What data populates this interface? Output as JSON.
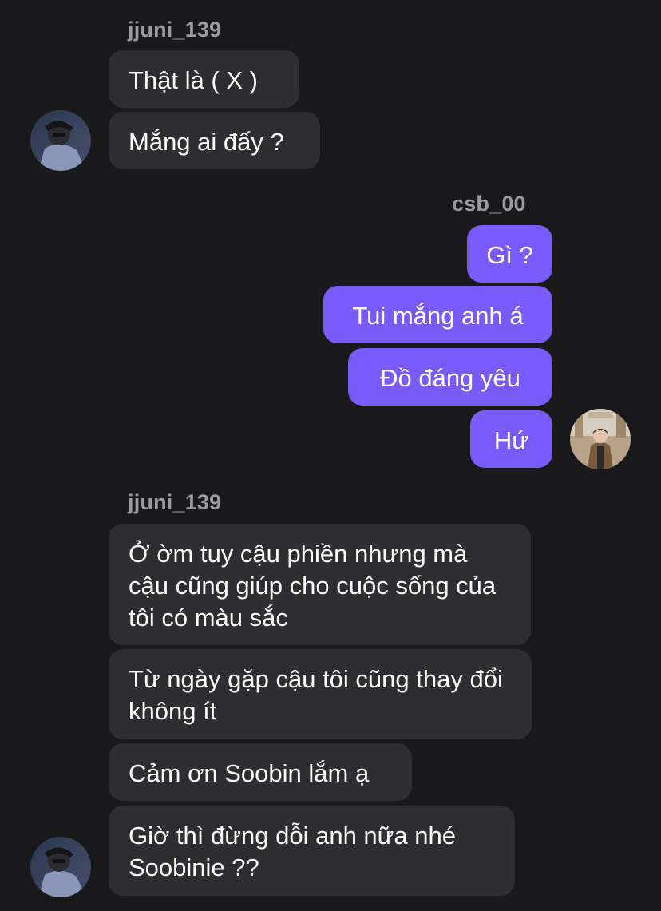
{
  "thread": {
    "groups": [
      {
        "sender": "jjuni_139",
        "side": "incoming",
        "messages": [
          "Thật là ( X )",
          "Mắng ai đấy ?"
        ]
      },
      {
        "sender": "csb_00",
        "side": "outgoing",
        "messages": [
          "Gì ?",
          "Tui mắng anh á",
          "Đồ đáng yêu",
          "Hứ"
        ]
      },
      {
        "sender": "jjuni_139",
        "side": "incoming",
        "messages": [
          "Ở ờm tuy cậu phiền nhưng mà cậu cũng giúp cho cuộc sống của tôi có màu sắc",
          "Từ ngày gặp cậu tôi cũng thay đổi không ít",
          "Cảm ơn Soobin lắm ạ",
          "Giờ thì đừng dỗi anh nữa nhé Soobinie ??"
        ]
      }
    ]
  },
  "colors": {
    "background": "#19191b",
    "incoming_bubble": "#2e2e31",
    "outgoing_bubble": "#7a5af8",
    "sender_name": "#9a9a9f"
  },
  "icons": {
    "incoming_avatar": "user-avatar-photo",
    "outgoing_avatar": "user-avatar-photo"
  }
}
